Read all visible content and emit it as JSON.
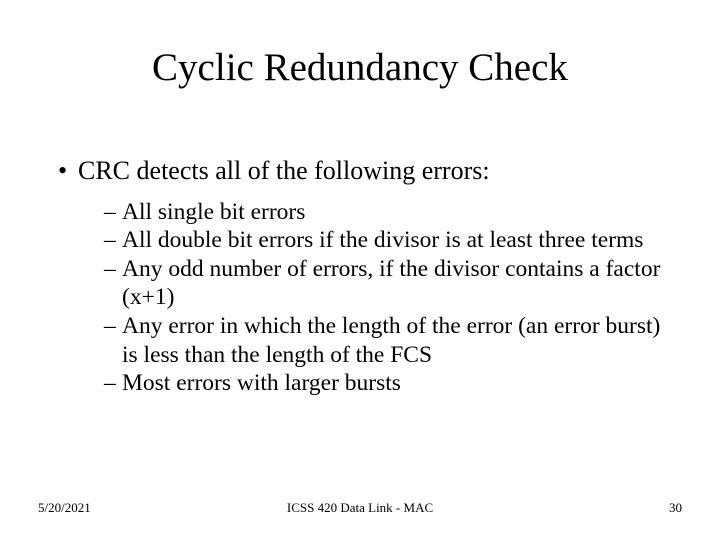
{
  "title": "Cyclic Redundancy Check",
  "main_bullet": {
    "marker": "•",
    "text": "CRC detects all of the following errors:"
  },
  "sub_bullets": [
    {
      "dash": "–",
      "text": "All single bit errors"
    },
    {
      "dash": "–",
      "text": "All double bit errors if the divisor is at least three terms"
    },
    {
      "dash": "–",
      "text": "Any odd number of errors, if the divisor contains a factor (x+1)"
    },
    {
      "dash": "–",
      "text": "Any error in which the length of the error (an error burst) is less than the length of the FCS"
    },
    {
      "dash": "–",
      "text": "Most errors with larger bursts"
    }
  ],
  "footer": {
    "date": "5/20/2021",
    "center": "ICSS 420 Data Link - MAC",
    "page": "30"
  }
}
